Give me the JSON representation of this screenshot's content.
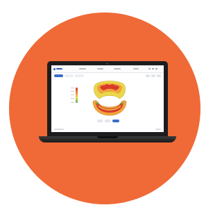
{
  "scene": {
    "background_color": "#ffffff",
    "circle_color": "#ef6a37",
    "laptop_color": "#1d1d1f"
  },
  "app": {
    "accent_color": "#3d6cc9",
    "header": {
      "logo_icon": "brand-logo-icon",
      "nav_items": [
        "",
        "",
        "",
        "",
        ""
      ],
      "window_controls": [
        "minimize-icon",
        "maximize-icon",
        "close-icon"
      ]
    },
    "tabs": [
      {
        "name": "tab-1",
        "active": true
      },
      {
        "name": "tab-2",
        "active": false
      },
      {
        "name": "tab-3",
        "active": false
      }
    ],
    "viewer": {
      "model": "dental-arch-occlusion-map",
      "heatmap_colors": [
        "#d93a2b",
        "#f0a43a",
        "#e9d84a",
        "#4bb35b"
      ]
    },
    "bottom_toolbar": [
      {
        "name": "tool-1",
        "active": false
      },
      {
        "name": "tool-2",
        "active": false
      },
      {
        "name": "tool-3",
        "active": true
      }
    ]
  }
}
